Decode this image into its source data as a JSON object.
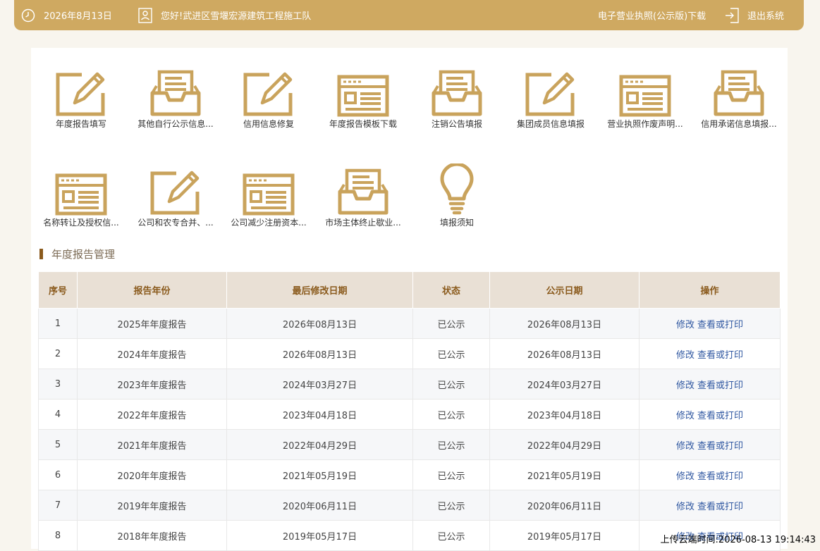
{
  "topbar": {
    "date": "2026年8月13日",
    "greeting": "您好!武进区雪堰宏源建筑工程施工队",
    "license_link": "电子营业执照(公示版)下载",
    "logout": "退出系统"
  },
  "tiles": [
    {
      "label": "年度报告填写",
      "icon": "edit-icon"
    },
    {
      "label": "其他自行公示信息...",
      "icon": "inbox-icon"
    },
    {
      "label": "信用信息修复",
      "icon": "edit-icon"
    },
    {
      "label": "年度报告模板下载",
      "icon": "form-icon"
    },
    {
      "label": "注销公告填报",
      "icon": "inbox-icon"
    },
    {
      "label": "集团成员信息填报",
      "icon": "edit-icon"
    },
    {
      "label": "营业执照作废声明...",
      "icon": "form-icon"
    },
    {
      "label": "信用承诺信息填报...",
      "icon": "inbox-icon"
    },
    {
      "label": "名称转让及授权信...",
      "icon": "form-icon"
    },
    {
      "label": "公司和农专合并、...",
      "icon": "edit-icon"
    },
    {
      "label": "公司减少注册资本...",
      "icon": "form-icon"
    },
    {
      "label": "市场主体终止歇业...",
      "icon": "inbox-icon"
    },
    {
      "label": "填报须知",
      "icon": "bulb-icon"
    }
  ],
  "section": {
    "title": "年度报告管理"
  },
  "table": {
    "headers": [
      "序号",
      "报告年份",
      "最后修改日期",
      "状态",
      "公示日期",
      "操作"
    ],
    "rows": [
      {
        "no": "1",
        "year": "2025年年度报告",
        "modified": "2026年08月13日",
        "status": "已公示",
        "published": "2026年08月13日",
        "edit": "修改",
        "view": "查看或打印"
      },
      {
        "no": "2",
        "year": "2024年年度报告",
        "modified": "2026年08月13日",
        "status": "已公示",
        "published": "2026年08月13日",
        "edit": "修改",
        "view": "查看或打印"
      },
      {
        "no": "3",
        "year": "2023年年度报告",
        "modified": "2024年03月27日",
        "status": "已公示",
        "published": "2024年03月27日",
        "edit": "修改",
        "view": "查看或打印"
      },
      {
        "no": "4",
        "year": "2022年年度报告",
        "modified": "2023年04月18日",
        "status": "已公示",
        "published": "2023年04月18日",
        "edit": "修改",
        "view": "查看或打印"
      },
      {
        "no": "5",
        "year": "2021年年度报告",
        "modified": "2022年04月29日",
        "status": "已公示",
        "published": "2022年04月29日",
        "edit": "修改",
        "view": "查看或打印"
      },
      {
        "no": "6",
        "year": "2020年年度报告",
        "modified": "2021年05月19日",
        "status": "已公示",
        "published": "2021年05月19日",
        "edit": "修改",
        "view": "查看或打印"
      },
      {
        "no": "7",
        "year": "2019年年度报告",
        "modified": "2020年06月11日",
        "status": "已公示",
        "published": "2020年06月11日",
        "edit": "修改",
        "view": "查看或打印"
      },
      {
        "no": "8",
        "year": "2018年年度报告",
        "modified": "2019年05月17日",
        "status": "已公示",
        "published": "2019年05月17日",
        "edit": "修改",
        "view": "查看或打印"
      }
    ]
  },
  "upload_stamp": "上传云端时间:2026-08-13 19:14:43",
  "colors": {
    "accent": "#cfa961",
    "header_bg": "#e9e0d5",
    "header_text": "#8a5a1c",
    "link": "#2f57a1"
  }
}
